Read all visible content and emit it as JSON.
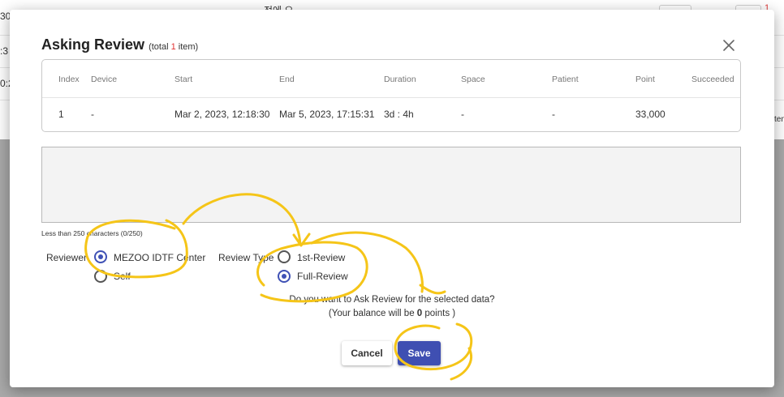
{
  "background": {
    "row1_fragment": "30",
    "row1_center": "전에 오",
    "row2_fragment": ":3",
    "row3_fragment": "0:2",
    "row1_badge": "1",
    "right_fragment": "ten"
  },
  "modal": {
    "title": "Asking Review",
    "subtitle_prefix": "(total ",
    "subtitle_count": "1",
    "subtitle_suffix": " item)",
    "close_icon": "close-icon"
  },
  "table": {
    "columns": [
      "Index",
      "Device",
      "Start",
      "End",
      "Duration",
      "Space",
      "Patient",
      "Point",
      "Succeeded"
    ],
    "rows": [
      [
        "1",
        "-",
        "Mar 2, 2023, 12:18:30",
        "Mar 5, 2023, 17:15:31",
        "3d : 4h",
        "-",
        "-",
        "33,000",
        ""
      ]
    ]
  },
  "comment": {
    "value": "",
    "hint": "Less than 250 characters (0/250)"
  },
  "reviewer": {
    "label": "Reviewer",
    "options": [
      "MEZOO IDTF Center",
      "Self"
    ],
    "selected": "MEZOO IDTF Center"
  },
  "review_type": {
    "label": "Review Type",
    "options": [
      "1st-Review",
      "Full-Review"
    ],
    "selected": "Full-Review"
  },
  "confirm": {
    "question": "Do you want to Ask Review for the selected data?",
    "balance_prefix": "(Your balance will be ",
    "balance_value": "0",
    "balance_suffix": " points )"
  },
  "buttons": {
    "cancel": "Cancel",
    "save": "Save"
  },
  "colors": {
    "accent": "#3f51b5",
    "save_button": "#3f4fb2",
    "count_red": "#e03131",
    "annotation_yellow": "#f5c518"
  }
}
